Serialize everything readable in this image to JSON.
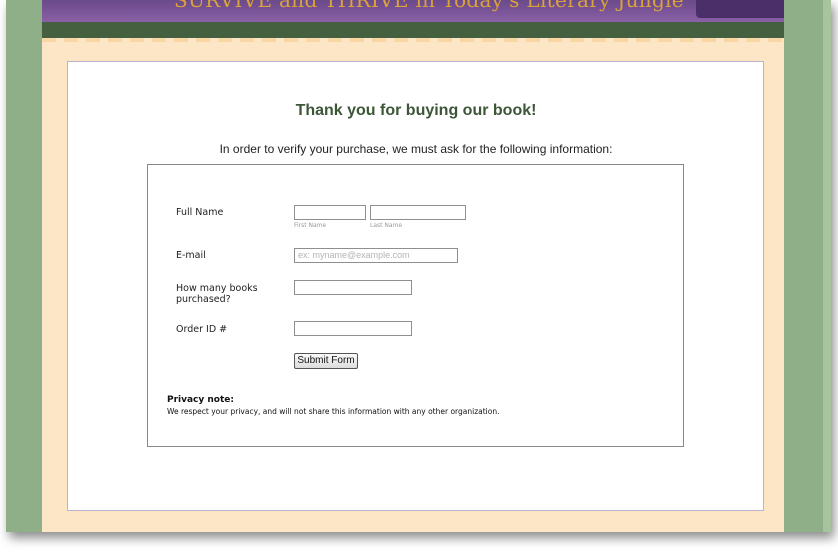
{
  "banner": {
    "text": "SURVIVE and THRIVE in Today's Literary Jungle"
  },
  "page": {
    "title": "Thank you for buying our book!",
    "intro": "In order to verify your purchase, we must ask for the following information:"
  },
  "form": {
    "full_name_label": "Full Name",
    "first_name": {
      "value": "",
      "sublabel": "First Name"
    },
    "last_name": {
      "value": "",
      "sublabel": "Last Name"
    },
    "email_label": "E-mail",
    "email": {
      "value": "",
      "placeholder": "ex: myname@example.com"
    },
    "books_label": "How many books purchased?",
    "books": {
      "value": ""
    },
    "order_label": "Order ID #",
    "order": {
      "value": ""
    },
    "submit_label": "Submit Form"
  },
  "privacy": {
    "title": "Privacy note:",
    "text": "We respect your privacy, and will not share this information with any other organization."
  },
  "colors": {
    "frame_green": "#8faf88",
    "banner_purple": "#6a4a8a",
    "banner_text_gold": "#d9a23c",
    "dark_green_band": "#45603f",
    "cream": "#fde6c5",
    "title_green": "#3c5637"
  }
}
